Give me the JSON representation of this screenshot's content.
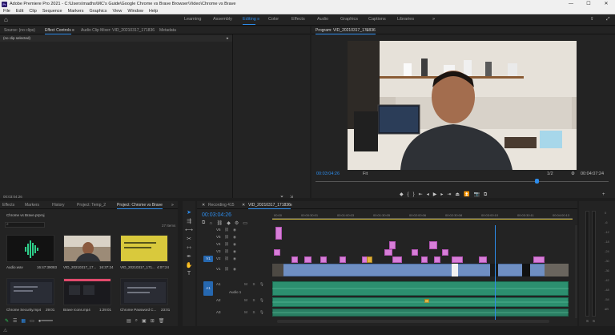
{
  "window": {
    "title": "Adobe Premiere Pro 2021 - C:\\Users\\madhs\\MC's Guide\\Google Chrome vs Brave Browser\\Video\\Chrome vs Brave",
    "app_badge": "Pr",
    "minimize": "—",
    "maximize": "☐",
    "close": "✕"
  },
  "menu": [
    "File",
    "Edit",
    "Clip",
    "Sequence",
    "Markers",
    "Graphics",
    "View",
    "Window",
    "Help"
  ],
  "workspaces": [
    {
      "label": "Learning",
      "active": false
    },
    {
      "label": "Assembly",
      "active": false
    },
    {
      "label": "Editing",
      "active": true
    },
    {
      "label": "Color",
      "active": false
    },
    {
      "label": "Effects",
      "active": false
    },
    {
      "label": "Audio",
      "active": false
    },
    {
      "label": "Graphics",
      "active": false
    },
    {
      "label": "Captions",
      "active": false
    },
    {
      "label": "Libraries",
      "active": false
    }
  ],
  "source_panel": {
    "tabs": [
      "Source: (no clips)",
      "Effect Controls",
      "Audio Clip Mixer: VID_20210317_171836",
      "Metadata"
    ],
    "active_tab": "Effect Controls",
    "no_clip": "(no clip selected)",
    "timecode": "00:03:04:26"
  },
  "program_panel": {
    "title": "Program: VID_20210317_171836",
    "timecode": "00:03:04:26",
    "fit": "Fit",
    "quality": "1/2",
    "duration": "00:04:07:24"
  },
  "project_panel": {
    "tabs": [
      "Effects",
      "Markers",
      "History",
      "Project: Temp_2",
      "Project: Chrome vs Brave"
    ],
    "active_tab": "Project: Chrome vs Brave",
    "path": "Chrome vs Brave.prproj",
    "item_count": "27 Items",
    "items": [
      {
        "name": "Audio.wav",
        "duration": "16:47:39083"
      },
      {
        "name": "VID_20210317_17...",
        "duration": "16:37:24"
      },
      {
        "name": "VID_20210317_171...",
        "duration": "4:07:24"
      },
      {
        "name": "Chrome Security.mp4",
        "duration": "29:01"
      },
      {
        "name": "Brave Icons.mp4",
        "duration": "1:29:01"
      },
      {
        "name": "Chrome Password C...",
        "duration": "23:01"
      }
    ]
  },
  "timeline_panel": {
    "tabs": [
      "Recording 415",
      "VID_20210317_171836"
    ],
    "active_tab": "VID_20210317_171836",
    "timecode": "00:03:04:26",
    "ruler": [
      "00:00",
      "00:00:30:01",
      "00:01:00:03",
      "00:01:30:05",
      "00:02:00:06",
      "00:02:30:08",
      "00:03:00:10",
      "00:03:30:11",
      "00:04:00:13"
    ],
    "video_tracks": [
      "V6",
      "V5",
      "V4",
      "V3",
      "V2",
      "V1"
    ],
    "audio_tracks": [
      "A1",
      "A2",
      "A3"
    ],
    "audio_track_name": "Audio 1",
    "source_patch_v": "V1",
    "source_patch_a": "A1"
  },
  "audio_meter": {
    "scale": [
      "0",
      "-6",
      "-12",
      "-18",
      "-24",
      "-30",
      "-36",
      "-42",
      "-48",
      "-54",
      "dB"
    ],
    "channels": [
      "S",
      "S"
    ]
  },
  "colors": {
    "accent": "#2d8ceb",
    "video_clip": "#d77ed8",
    "video_clip_blue": "#6f8fc3",
    "audio_clip": "#2c8f6f"
  }
}
